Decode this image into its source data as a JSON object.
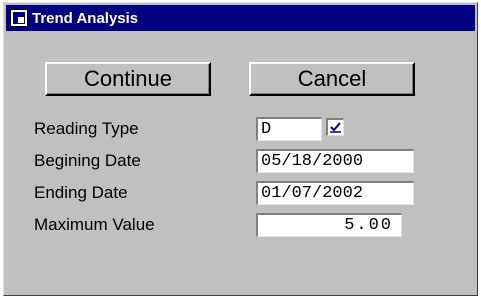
{
  "window": {
    "title": "Trend Analysis",
    "icon": "app-icon"
  },
  "buttons": {
    "continue_label": "Continue",
    "cancel_label": "Cancel"
  },
  "fields": {
    "reading_type": {
      "label": "Reading Type",
      "value": "D",
      "checkbox_checked": true
    },
    "begining_date": {
      "label": "Begining Date",
      "value": "05/18/2000"
    },
    "ending_date": {
      "label": "Ending Date",
      "value": "01/07/2002"
    },
    "maximum_value": {
      "label": "Maximum Value",
      "value": "5.00"
    }
  },
  "colors": {
    "titlebar": "#000080",
    "window_bg": "#c0c0c0"
  }
}
